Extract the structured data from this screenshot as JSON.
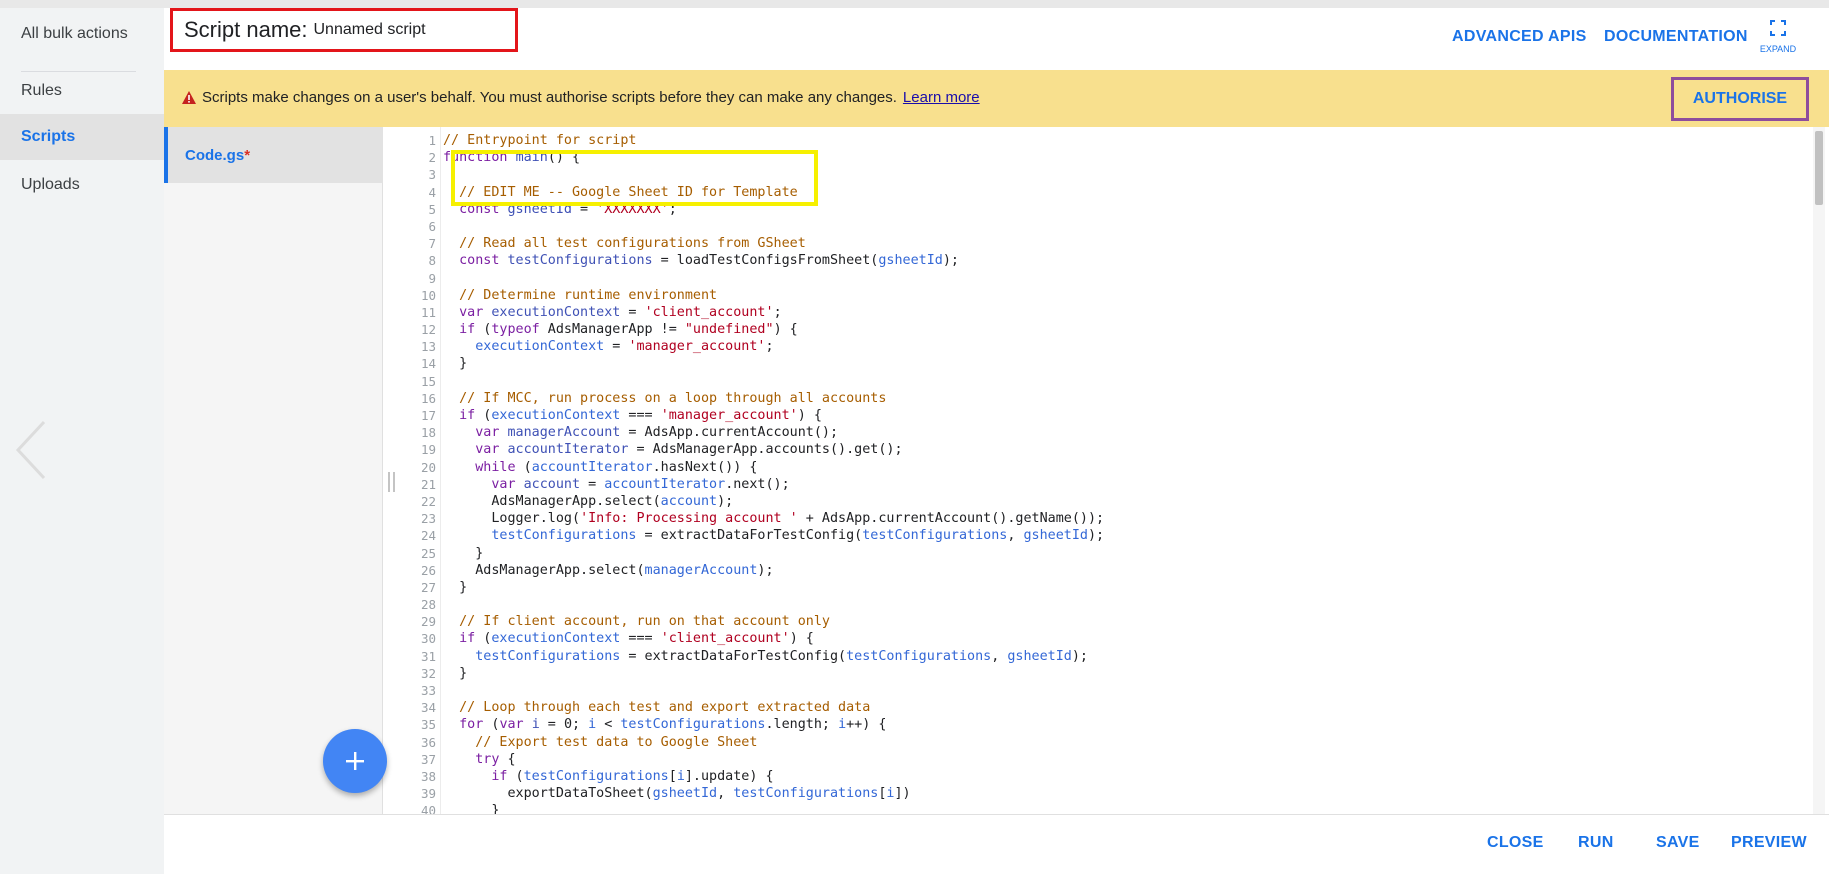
{
  "nav": {
    "items": [
      {
        "label": "All bulk actions"
      },
      {
        "label": "Rules"
      },
      {
        "label": "Scripts"
      },
      {
        "label": "Uploads"
      }
    ]
  },
  "header": {
    "script_name_label": "Script name:",
    "script_name_value": "Unnamed script",
    "advanced_apis": "ADVANCED APIS",
    "documentation": "DOCUMENTATION",
    "expand": "EXPAND"
  },
  "warning": {
    "text": "Scripts make changes on a user's behalf. You must authorise scripts before they can make any changes.",
    "learn_more": "Learn more",
    "authorise": "AUTHORISE"
  },
  "files": {
    "active_file": "Code.gs",
    "dirty_marker": "*"
  },
  "editor": {
    "line_numbers": [
      "1",
      "2",
      "3",
      "4",
      "5",
      "6",
      "7",
      "8",
      "9",
      "10",
      "11",
      "12",
      "13",
      "14",
      "15",
      "16",
      "17",
      "18",
      "19",
      "20",
      "21",
      "22",
      "23",
      "24",
      "25",
      "26",
      "27",
      "28",
      "29",
      "30",
      "31",
      "32",
      "33",
      "34",
      "35",
      "36",
      "37",
      "38",
      "39",
      "40"
    ]
  },
  "footer": {
    "close": "CLOSE",
    "run": "RUN",
    "save": "SAVE",
    "preview": "PREVIEW"
  },
  "colors": {
    "accent": "#1a73e8",
    "warning_bg": "#f8e08e",
    "script_name_outline": "#e3151a",
    "authorise_outline": "#8e4d9c",
    "code_highlight_outline": "#f6f000",
    "fab": "#4285f4"
  },
  "icons": {
    "warning": "warning-triangle-icon",
    "expand": "fullscreen-icon",
    "fab": "plus-icon",
    "back": "chevron-left-icon"
  }
}
